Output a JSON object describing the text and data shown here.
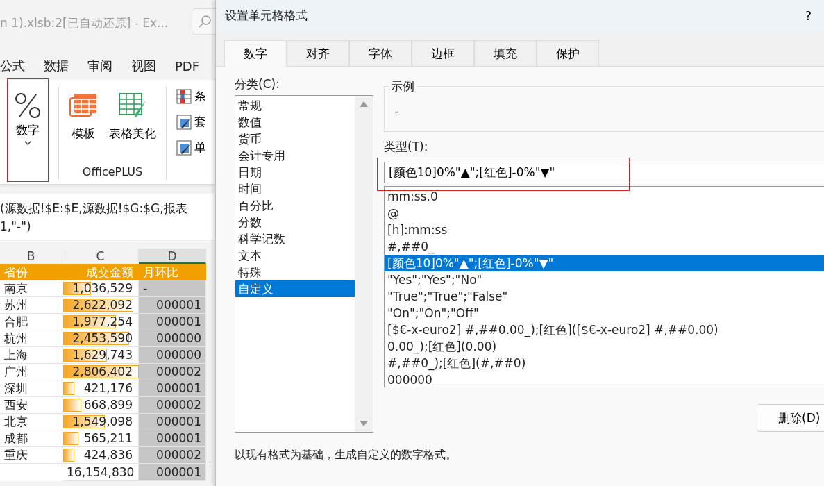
{
  "excel": {
    "title": "n 1).xlsb:2[已自动还原]  -  Ex...",
    "menu": [
      {
        "label": "公式"
      },
      {
        "label": "数据"
      },
      {
        "label": "审阅"
      },
      {
        "label": "视图"
      },
      {
        "label": "PDF"
      }
    ],
    "ribbon": {
      "number_button": {
        "label": "数字",
        "highlighted": true
      },
      "officeplus": {
        "buttons": [
          {
            "label": "模板",
            "kind": "template"
          },
          {
            "label": "表格美化",
            "kind": "beautify"
          }
        ],
        "group_label": "OfficePLUS"
      },
      "side_items": [
        {
          "label": "条",
          "kind": "conditional"
        },
        {
          "label": "套",
          "kind": "format"
        },
        {
          "label": "单",
          "kind": "format"
        }
      ]
    },
    "formula": [
      "(源数据!$E:$E,源数据!$G:$G,报表",
      "1,\"-\")"
    ],
    "sheet": {
      "columns": [
        {
          "label": "B",
          "selected": false
        },
        {
          "label": "C",
          "selected": false
        },
        {
          "label": "D",
          "selected": true
        }
      ],
      "headers": [
        "省份",
        "成交金额",
        "月环比"
      ],
      "rows": [
        {
          "province": "南京",
          "amount": "1,036,529",
          "level": 0.37,
          "mom": "-"
        },
        {
          "province": "苏州",
          "amount": "2,622,092",
          "level": 0.93,
          "mom": "000001"
        },
        {
          "province": "合肥",
          "amount": "1,977,254",
          "level": 0.7,
          "mom": "000001"
        },
        {
          "province": "杭州",
          "amount": "2,453,590",
          "level": 0.87,
          "mom": "000000"
        },
        {
          "province": "上海",
          "amount": "1,629,743",
          "level": 0.58,
          "mom": "000000"
        },
        {
          "province": "广州",
          "amount": "2,806,402",
          "level": 1.0,
          "mom": "000002"
        },
        {
          "province": "深圳",
          "amount": "421,176",
          "level": 0.15,
          "mom": "000001"
        },
        {
          "province": "西安",
          "amount": "668,899",
          "level": 0.24,
          "mom": "000002"
        },
        {
          "province": "北京",
          "amount": "1,549,098",
          "level": 0.55,
          "mom": "000001"
        },
        {
          "province": "成都",
          "amount": "565,211",
          "level": 0.2,
          "mom": "000001"
        },
        {
          "province": "重庆",
          "amount": "424,836",
          "level": 0.15,
          "mom": "000002"
        }
      ],
      "total": {
        "amount": "16,154,830",
        "mom": "000001"
      }
    }
  },
  "dialog": {
    "title": "设置单元格格式",
    "help": "?",
    "tabs": [
      {
        "label": "数字",
        "selected": true
      },
      {
        "label": "对齐",
        "selected": false
      },
      {
        "label": "字体",
        "selected": false
      },
      {
        "label": "边框",
        "selected": false
      },
      {
        "label": "填充",
        "selected": false
      },
      {
        "label": "保护",
        "selected": false
      }
    ],
    "category_label": "分类(C):",
    "categories": [
      {
        "label": "常规",
        "selected": false
      },
      {
        "label": "数值",
        "selected": false
      },
      {
        "label": "货币",
        "selected": false
      },
      {
        "label": "会计专用",
        "selected": false
      },
      {
        "label": "日期",
        "selected": false
      },
      {
        "label": "时间",
        "selected": false
      },
      {
        "label": "百分比",
        "selected": false
      },
      {
        "label": "分数",
        "selected": false
      },
      {
        "label": "科学记数",
        "selected": false
      },
      {
        "label": "文本",
        "selected": false
      },
      {
        "label": "特殊",
        "selected": false
      },
      {
        "label": "自定义",
        "selected": true
      }
    ],
    "sample": {
      "label": "示例",
      "value": "-"
    },
    "type": {
      "label": "类型(T):",
      "value": "[颜色10]0%\"▲\";[红色]-0%\"▼\"",
      "highlighted": true
    },
    "formats": [
      {
        "label": "mm:ss.0",
        "selected": false
      },
      {
        "label": "@",
        "selected": false
      },
      {
        "label": "[h]:mm:ss",
        "selected": false
      },
      {
        "label": "#,##0_",
        "selected": false
      },
      {
        "label": "[颜色10]0%\"▲\";[红色]-0%\"▼\"",
        "selected": true
      },
      {
        "label": "\"Yes\";\"Yes\";\"No\"",
        "selected": false
      },
      {
        "label": "\"True\";\"True\";\"False\"",
        "selected": false
      },
      {
        "label": "\"On\";\"On\";\"Off\"",
        "selected": false
      },
      {
        "label": "[$€-x-euro2] #,##0.00_);[红色]([$€-x-euro2] #,##0.00)",
        "selected": false
      },
      {
        "label": "0.00_);[红色](0.00)",
        "selected": false
      },
      {
        "label": "#,##0_);[红色](#,##0)",
        "selected": false
      },
      {
        "label": "000000",
        "selected": false
      }
    ],
    "delete_button": "删除(D)",
    "description": "以现有格式为基础，生成自定义的数字格式。"
  }
}
